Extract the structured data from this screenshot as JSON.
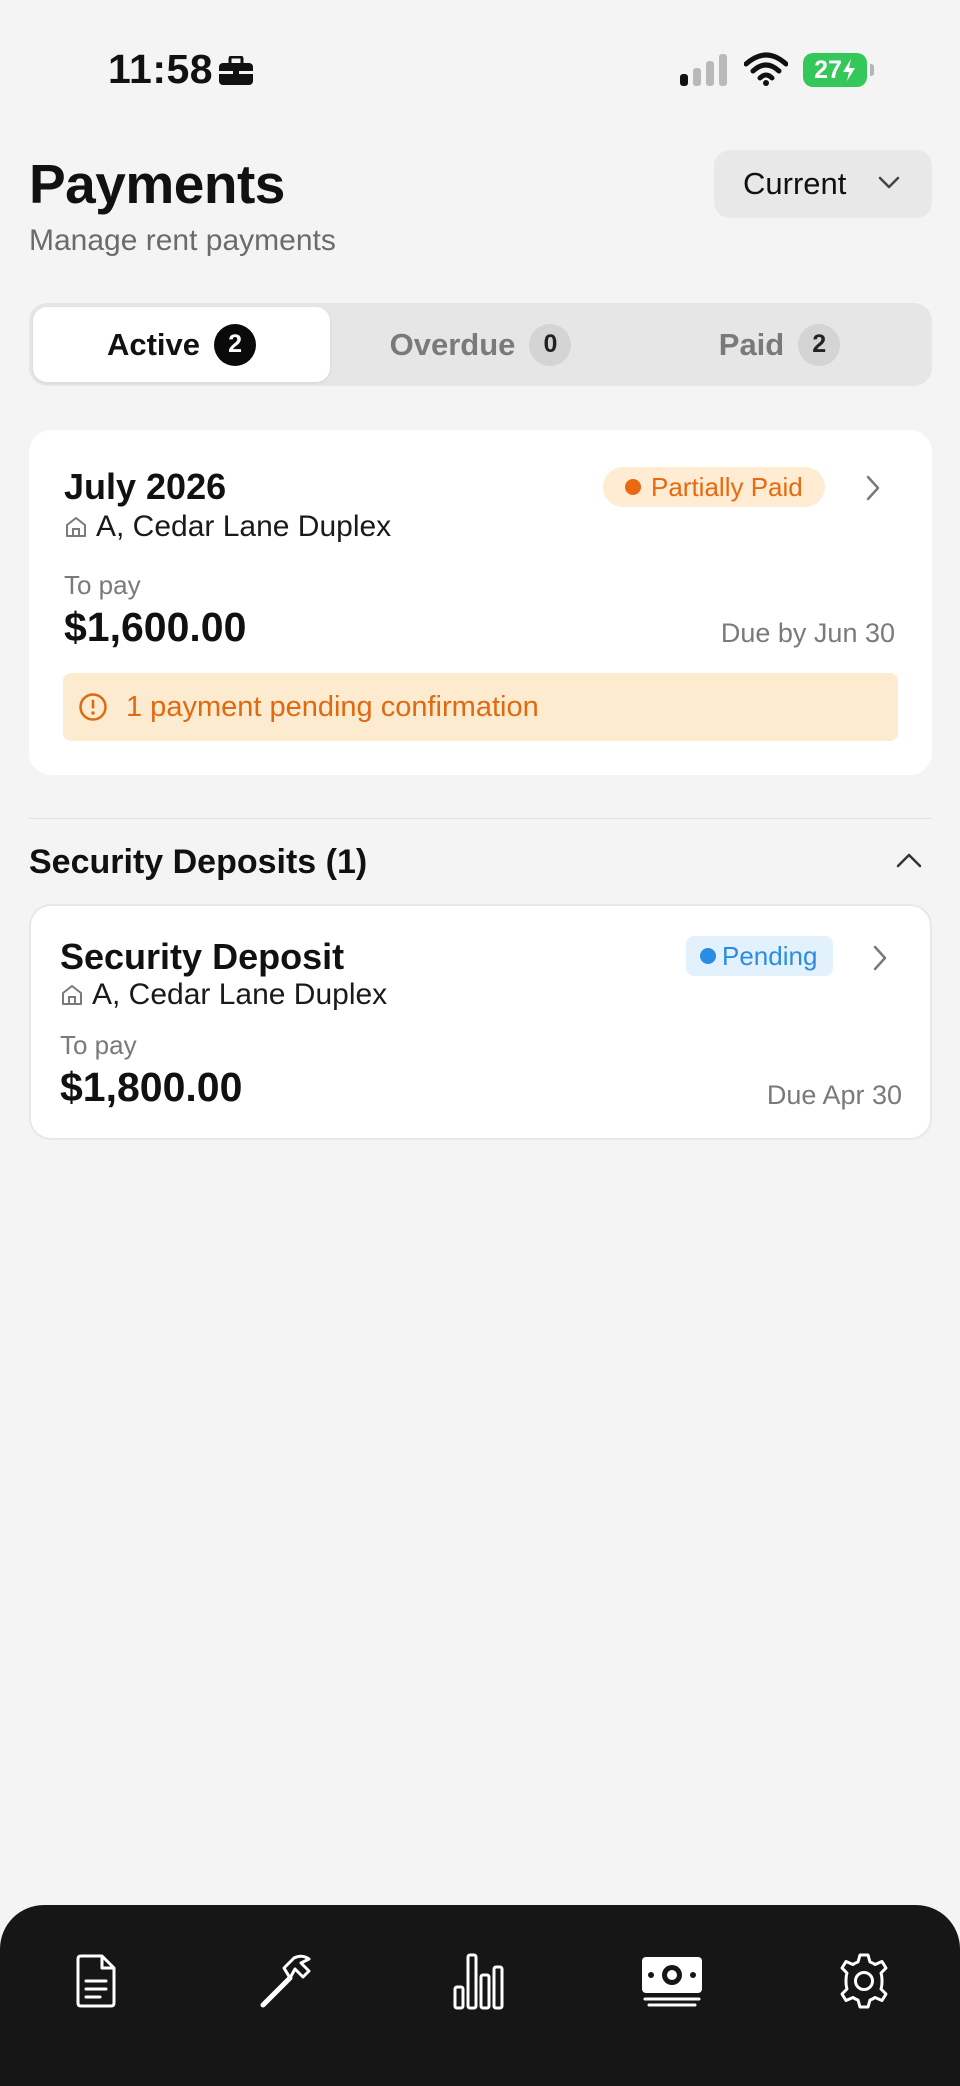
{
  "status_bar": {
    "time": "11:58",
    "battery": "27"
  },
  "header": {
    "title": "Payments",
    "subtitle": "Manage rent payments",
    "period_select": "Current"
  },
  "tabs": [
    {
      "label": "Active",
      "count": "2",
      "selected": true
    },
    {
      "label": "Overdue",
      "count": "0",
      "selected": false
    },
    {
      "label": "Paid",
      "count": "2",
      "selected": false
    }
  ],
  "rent_card": {
    "title": "July 2026",
    "status": "Partially Paid",
    "property": "A, Cedar Lane Duplex",
    "to_pay_label": "To pay",
    "amount": "$1,600.00",
    "due": "Due by Jun 30",
    "notice": "1 payment pending confirmation"
  },
  "deposits_section": {
    "title": "Security Deposits (1)",
    "items": [
      {
        "title": "Security Deposit",
        "status": "Pending",
        "property": "A, Cedar Lane Duplex",
        "to_pay_label": "To pay",
        "amount": "$1,800.00",
        "due": "Due Apr 30"
      }
    ]
  },
  "colors": {
    "partial": "#e8690f",
    "pending": "#2a8de3",
    "nav_bg": "#161616",
    "battery": "#34c759"
  },
  "bottom_nav": [
    {
      "icon": "document-icon"
    },
    {
      "icon": "hammer-icon"
    },
    {
      "icon": "bar-chart-icon"
    },
    {
      "icon": "money-icon",
      "active": true
    },
    {
      "icon": "gear-icon"
    }
  ]
}
